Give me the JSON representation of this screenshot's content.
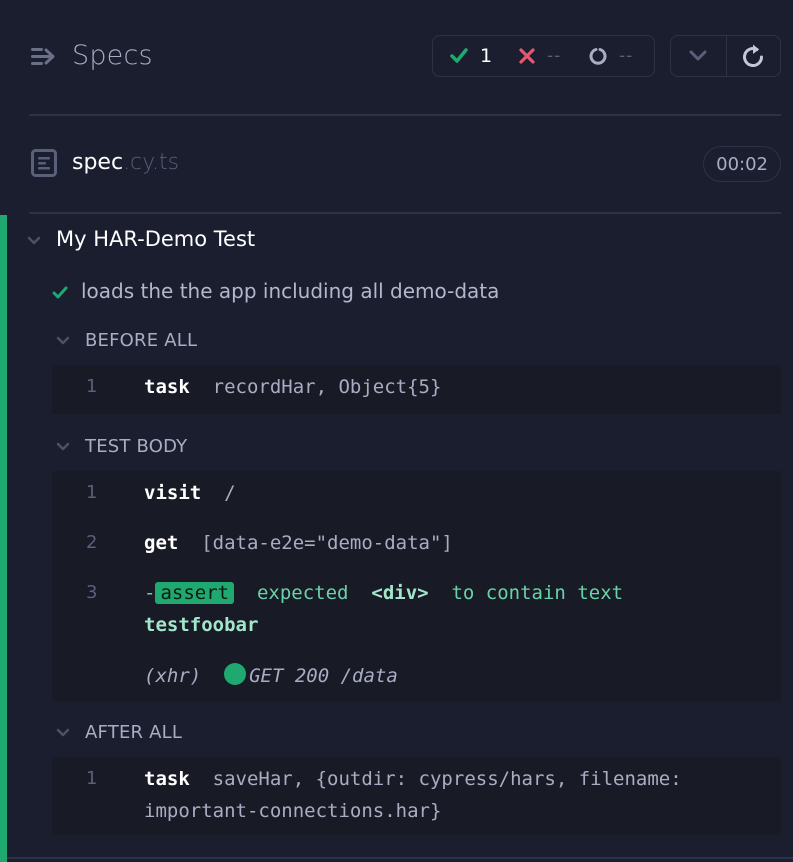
{
  "header": {
    "title": "Specs",
    "stats": {
      "passed": "1",
      "failed": "--",
      "pending": "--"
    },
    "icons": {
      "specs": "list-arrow-icon",
      "passed": "check-icon",
      "failed": "x-icon",
      "pending": "spinner-icon",
      "collapse": "chevron-down-icon",
      "rerun": "refresh-icon"
    }
  },
  "spec": {
    "basename": "spec",
    "extension": ".cy.ts",
    "duration": "00:02"
  },
  "suite": {
    "title": "My HAR-Demo Test",
    "test": {
      "title": "loads the the app including all demo-data",
      "state": "passed",
      "hooks": [
        {
          "label": "BEFORE ALL",
          "commands": [
            {
              "num": "1",
              "name": "task",
              "message": "recordHar, Object{5}"
            }
          ]
        },
        {
          "label": "TEST BODY",
          "commands": [
            {
              "num": "1",
              "name": "visit",
              "message": "/"
            },
            {
              "num": "2",
              "name": "get",
              "message": "[data-e2e=\"demo-data\"]"
            },
            {
              "num": "3",
              "prefix": "-",
              "name": "assert",
              "message_parts": [
                "expected",
                "<div>",
                "to contain text",
                "testfoobar"
              ]
            },
            {
              "type": "xhr",
              "label": "(xhr)",
              "message": "GET 200 /data"
            }
          ]
        },
        {
          "label": "AFTER ALL",
          "commands": [
            {
              "num": "1",
              "name": "task",
              "message_line1": "saveHar, {outdir: cypress/hars, filename:",
              "message_line2": "important-connections.har}"
            }
          ]
        }
      ]
    }
  },
  "colors": {
    "background": "#1b1e2e",
    "command_block": "#181a26",
    "border": "#2e3246",
    "pass": "#1fa971",
    "fail": "#e45770",
    "muted": "#5a5f7a",
    "text": "#a9adc4"
  }
}
